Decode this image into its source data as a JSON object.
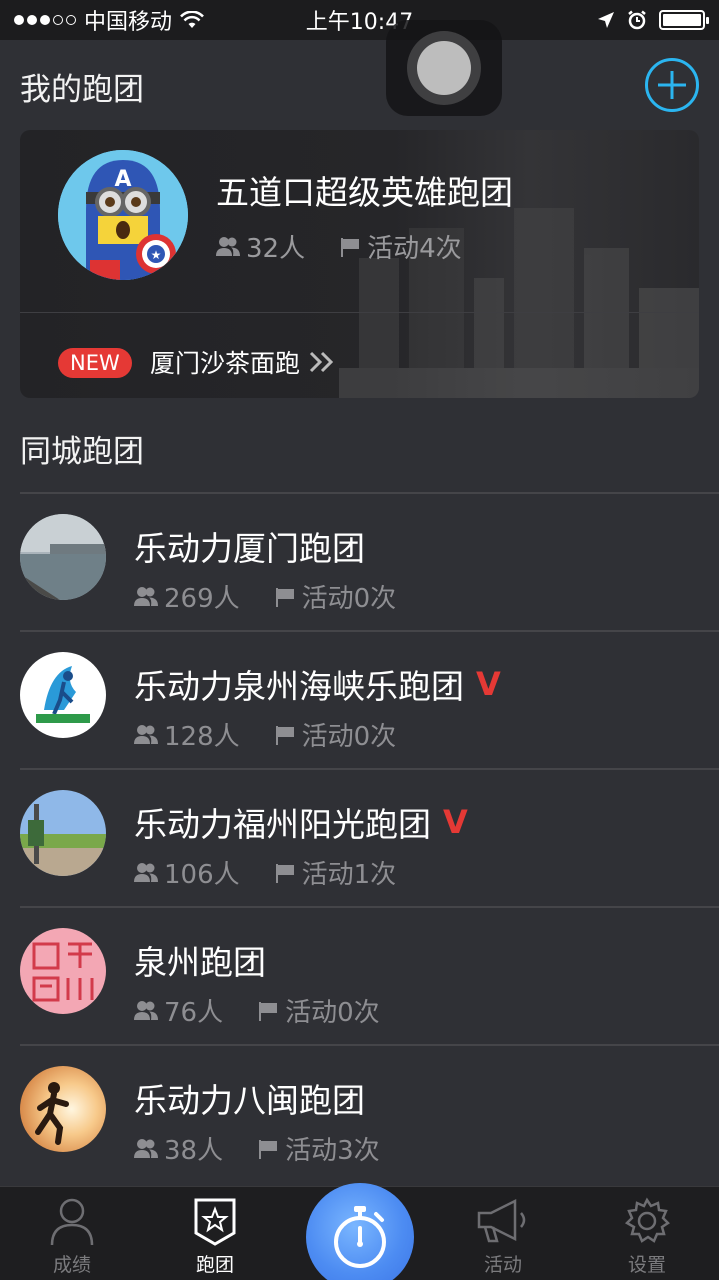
{
  "status_bar": {
    "carrier": "中国移动",
    "time": "上午10:47"
  },
  "my_teams": {
    "header": "我的跑团",
    "card": {
      "name": "五道口超级英雄跑团",
      "members": "32人",
      "activities": "活动4次",
      "new_badge": "NEW",
      "new_item": "厦门沙茶面跑"
    }
  },
  "city_teams": {
    "header": "同城跑团",
    "items": [
      {
        "name": "乐动力厦门跑团",
        "members": "269人",
        "activities": "活动0次",
        "verified": false
      },
      {
        "name": "乐动力泉州海峡乐跑团",
        "members": "128人",
        "activities": "活动0次",
        "verified": true,
        "badge": "V"
      },
      {
        "name": "乐动力福州阳光跑团",
        "members": "106人",
        "activities": "活动1次",
        "verified": true,
        "badge": "V"
      },
      {
        "name": "泉州跑团",
        "members": "76人",
        "activities": "活动0次",
        "verified": false
      },
      {
        "name": "乐动力八闽跑团",
        "members": "38人",
        "activities": "活动3次",
        "verified": false
      }
    ]
  },
  "tab_bar": {
    "tabs": [
      {
        "label": "成绩",
        "icon": "person-icon"
      },
      {
        "label": "跑团",
        "icon": "shield-star-icon",
        "active": true
      },
      {
        "label": "活动",
        "icon": "megaphone-icon"
      },
      {
        "label": "设置",
        "icon": "gear-icon"
      }
    ],
    "center_icon": "stopwatch-icon"
  },
  "colors": {
    "background": "#2f3035",
    "accent": "#2bb5f0",
    "badge_red": "#e53935",
    "stopwatch_blue": "#4d8cf2"
  }
}
